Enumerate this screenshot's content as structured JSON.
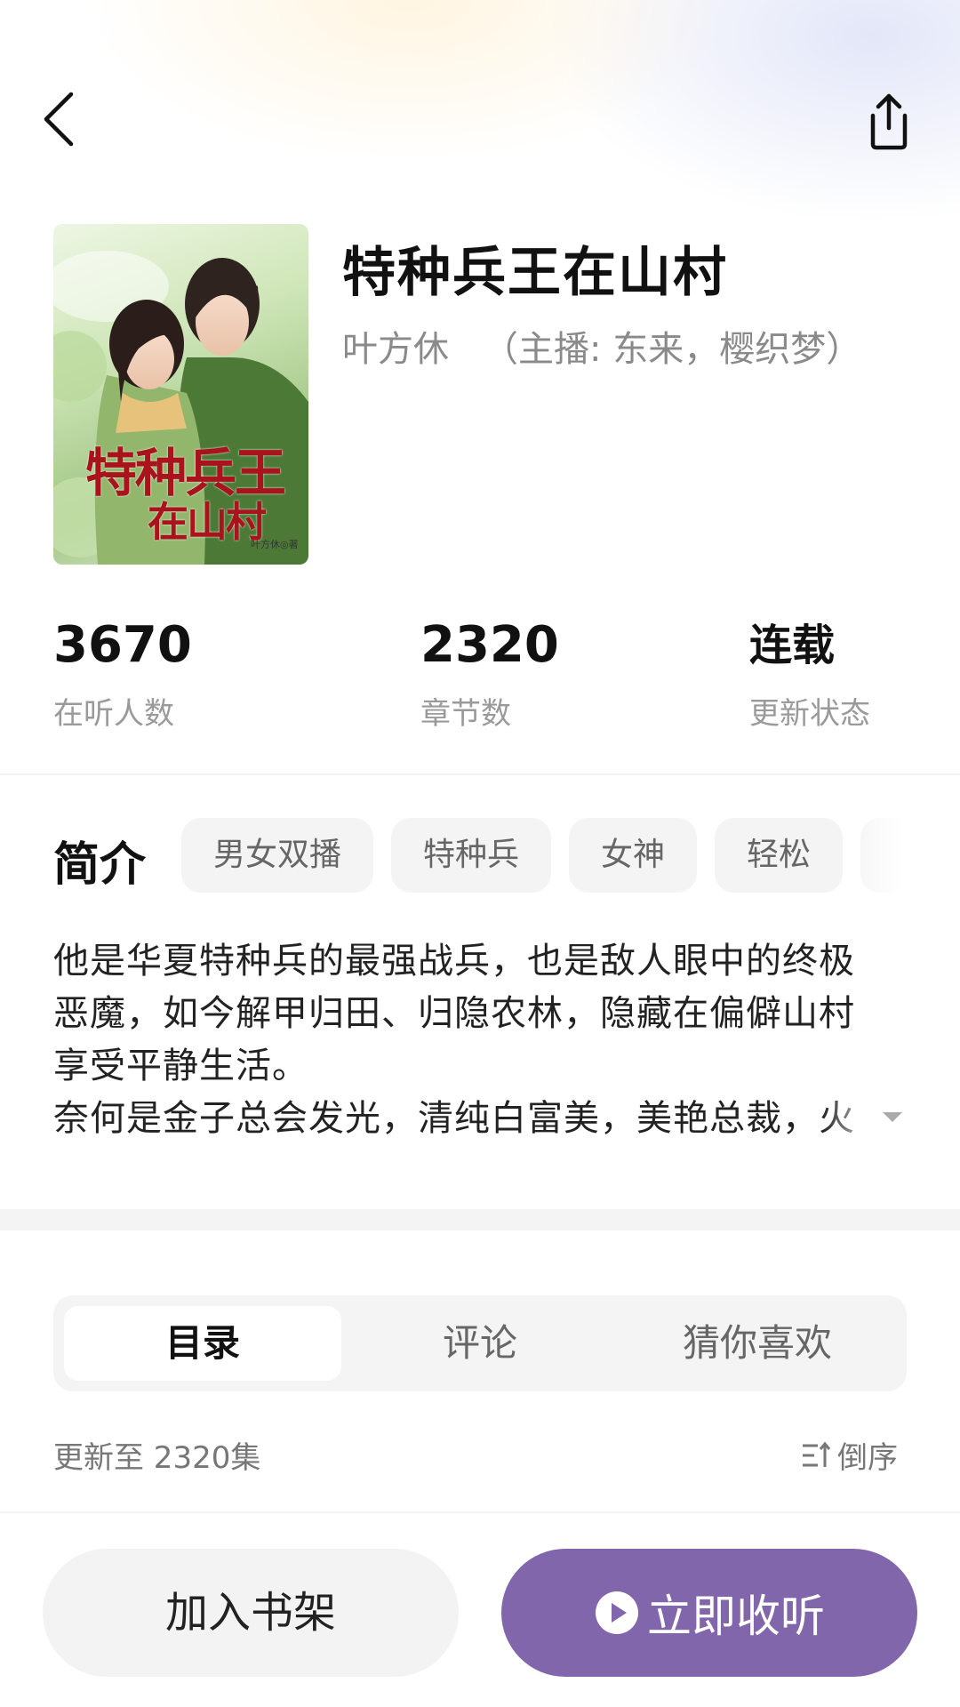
{
  "book": {
    "title": "特种兵王在山村",
    "author": "叶方休",
    "narrators": "（主播: 东来，樱织梦）",
    "cover": {
      "title_line1": "特种兵王",
      "title_line2": "在山村",
      "author_mark": "叶方休◎著"
    }
  },
  "stats": [
    {
      "value": "3670",
      "label": "在听人数"
    },
    {
      "value": "2320",
      "label": "章节数"
    },
    {
      "value": "连载",
      "label": "更新状态"
    }
  ],
  "intro": {
    "heading": "简介",
    "tags": [
      "男女双播",
      "特种兵",
      "女神",
      "轻松"
    ],
    "lines": [
      "他是华夏特种兵的最强战兵，也是敌人眼中的终极",
      "恶魔，如今解甲归田、归隐农林，隐藏在偏僻山村",
      "享受平静生活。",
      "奈何是金子总会发光，清纯白富美，美艳总裁，火"
    ]
  },
  "tabs": [
    {
      "label": "目录",
      "active": true
    },
    {
      "label": "评论",
      "active": false
    },
    {
      "label": "猜你喜欢",
      "active": false
    }
  ],
  "catalog": {
    "update_text": "更新至 2320集",
    "sort_label": "倒序"
  },
  "actions": {
    "shelf_label": "加入书架",
    "listen_label": "立即收听"
  },
  "colors": {
    "accent": "#8266ab"
  },
  "icons": [
    "back-arrow-icon",
    "share-icon",
    "play-icon",
    "sort-icon",
    "expand-arrow-icon"
  ]
}
